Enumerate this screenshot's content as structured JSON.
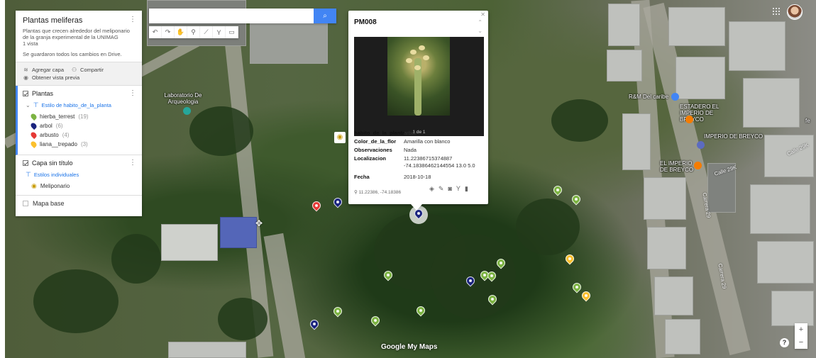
{
  "panel": {
    "title": "Plantas meliferas",
    "description": "Plantas que crecen alrededor del meliponario de la granja experimental de la UNIMAG",
    "views": "1 vista",
    "saved": "Se guardaron todos los cambios en Drive.",
    "add_layer": "Agregar capa",
    "share": "Compartir",
    "preview": "Obtener vista previa",
    "layers": [
      {
        "name": "Plantas",
        "style": "Estilo de habito_de_la_planta",
        "items": [
          {
            "label": "hierba_terrest",
            "count": "(19)",
            "color": "#7cb342"
          },
          {
            "label": "arbol",
            "count": "(6)",
            "color": "#1a237e"
          },
          {
            "label": "arbusto",
            "count": "(4)",
            "color": "#e53935"
          },
          {
            "label": "liana__trepado",
            "count": "(3)",
            "color": "#fbc02d"
          }
        ]
      },
      {
        "name": "Capa sin título",
        "style": "Estilos individuales",
        "items": [
          {
            "label": "Meliponario"
          }
        ]
      }
    ],
    "base_map": "Mapa base"
  },
  "search": {
    "placeholder": ""
  },
  "popup": {
    "title": "PM008",
    "photo_counter": "1 de 1",
    "fields": [
      {
        "key": "habito_de_la_planta",
        "value": "arbol"
      },
      {
        "key": "Color_de_la_flor",
        "value": "Amarilla con blanco"
      },
      {
        "key": "Observaciones",
        "value": "Nada"
      },
      {
        "key": "Localizacion",
        "value": "11.22386715374887 -74.18386462144554 13.0 5.0"
      },
      {
        "key": "Fecha",
        "value": "2018-10-18"
      }
    ],
    "coords": "11.22386, -74.18386"
  },
  "map_labels": {
    "lab": "Laboratorio De Arqueologia",
    "rm": "R&M Del caribe",
    "estadero": "ESTADERO EL IMPERIO DE BREYCO",
    "imperio1": "IMPERIO DE BREYCO",
    "imperio2": "EL IMPERIO DE BREYCO",
    "calle_a": "Calle 29K",
    "calle_b": "Calle 29K",
    "carrera_a": "Carrera 29",
    "carrera_b": "Carrera 29",
    "fe": "fe"
  },
  "brand": "Google My Maps",
  "zoom": {
    "in": "+",
    "out": "−"
  },
  "help": "?"
}
